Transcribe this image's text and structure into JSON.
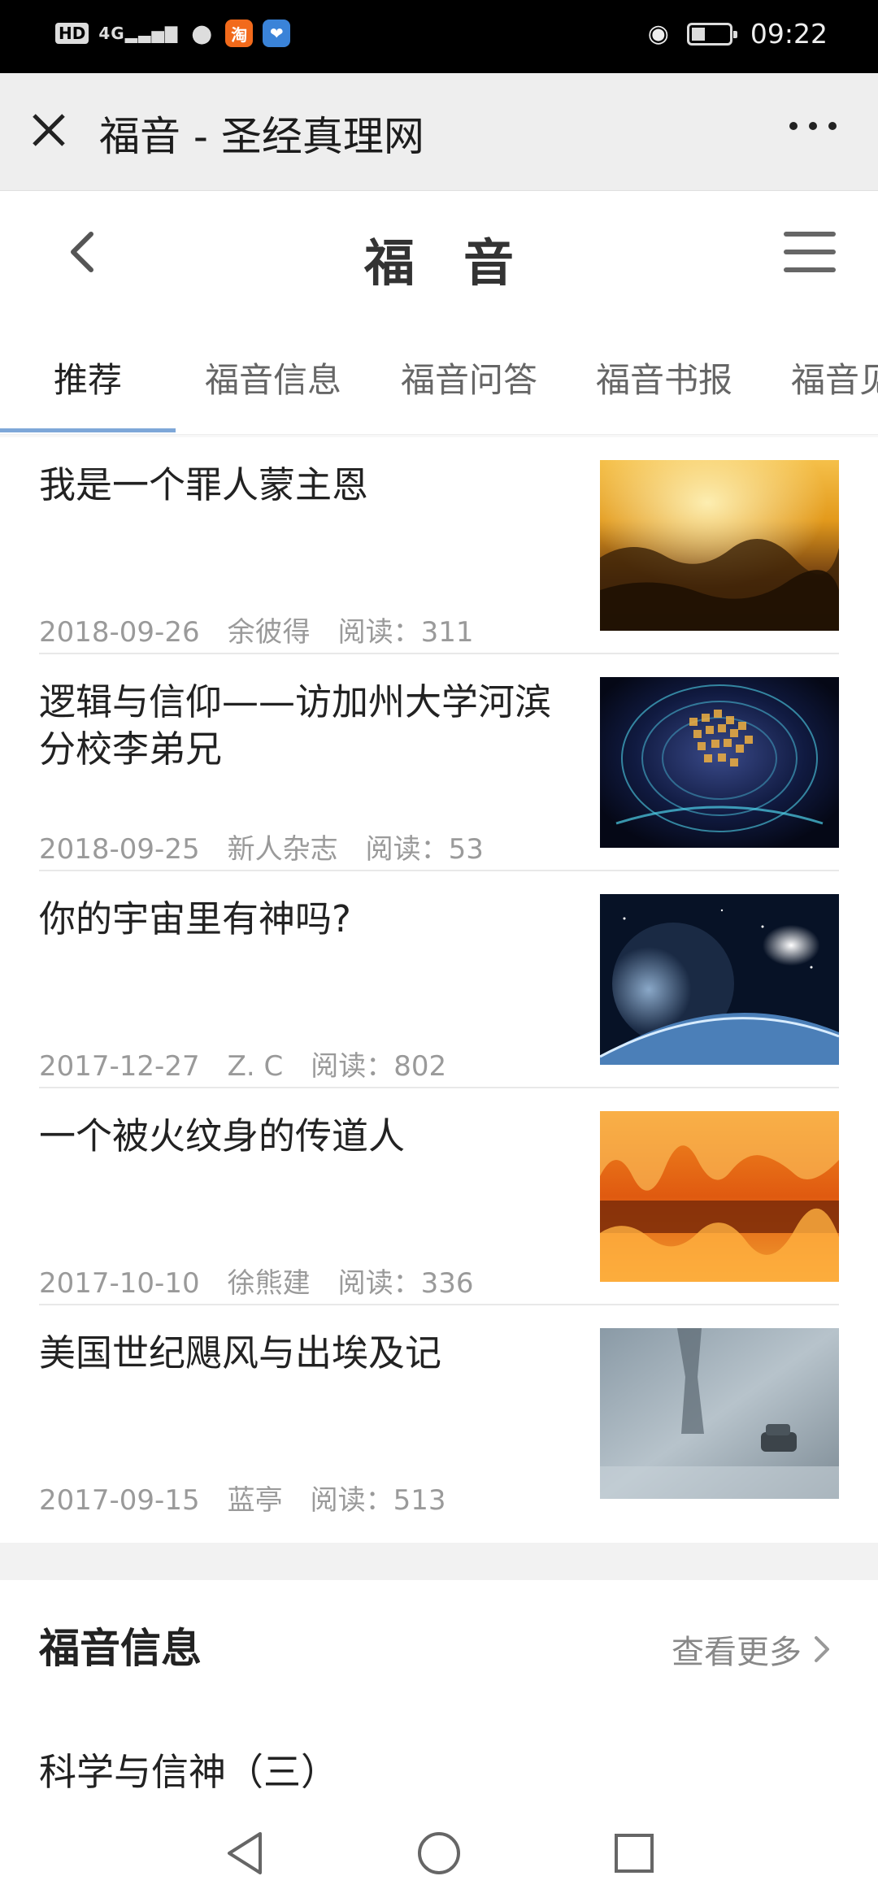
{
  "status_bar": {
    "time": "09:22",
    "hd_label": "HD",
    "signal_label": "4G",
    "taobao_label": "淘",
    "icons": [
      "hd-icon",
      "signal-icon",
      "wechat-icon",
      "taobao-icon",
      "app-icon",
      "eye-icon",
      "battery-icon"
    ]
  },
  "title_bar": {
    "title": "福音 - 圣经真理网"
  },
  "site_header": {
    "title": "福音"
  },
  "tabs": [
    {
      "label": "推荐",
      "active": true
    },
    {
      "label": "福音信息",
      "active": false
    },
    {
      "label": "福音问答",
      "active": false
    },
    {
      "label": "福音书报",
      "active": false
    },
    {
      "label": "福音见",
      "active": false
    }
  ],
  "articles": [
    {
      "title": "我是一个罪人蒙主恩",
      "date": "2018-09-26",
      "author": "余彼得",
      "reads": "阅读：311"
    },
    {
      "title": "逻辑与信仰——访加州大学河滨分校李弟兄",
      "date": "2018-09-25",
      "author": "新人杂志",
      "reads": "阅读：53"
    },
    {
      "title": "你的宇宙里有神吗?",
      "date": "2017-12-27",
      "author": "Z. C",
      "reads": "阅读：802"
    },
    {
      "title": "一个被火纹身的传道人",
      "date": "2017-10-10",
      "author": "徐熊建",
      "reads": "阅读：336"
    },
    {
      "title": "美国世纪飓风与出埃及记",
      "date": "2017-09-15",
      "author": "蓝亭",
      "reads": "阅读：513"
    }
  ],
  "section": {
    "title": "福音信息",
    "see_more": "查看更多",
    "first_item": "科学与信神（三）"
  },
  "colors": {
    "tab_underline": "#7ea7d8",
    "meta_text": "#9a9a9a",
    "taobao": "#f26a1b"
  }
}
